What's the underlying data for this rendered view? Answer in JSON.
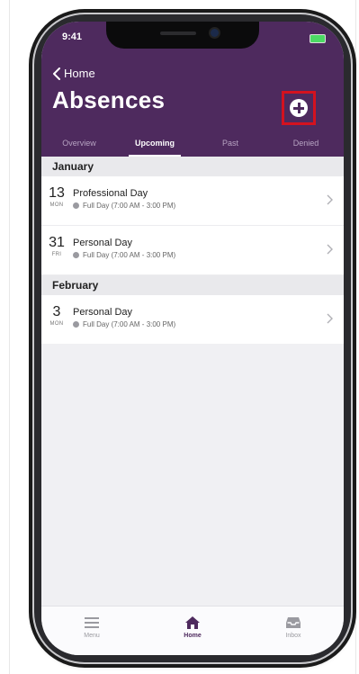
{
  "status_bar": {
    "time": "9:41"
  },
  "nav": {
    "back_label": "Home",
    "title": "Absences"
  },
  "tabs": [
    {
      "label": "Overview",
      "active": false
    },
    {
      "label": "Upcoming",
      "active": true
    },
    {
      "label": "Past",
      "active": false
    },
    {
      "label": "Denied",
      "active": false
    }
  ],
  "sections": [
    {
      "month": "January",
      "items": [
        {
          "day": "13",
          "dow": "MON",
          "name": "Professional Day",
          "detail": "Full Day (7:00 AM - 3:00 PM)"
        },
        {
          "day": "31",
          "dow": "FRI",
          "name": "Personal Day",
          "detail": "Full Day (7:00 AM - 3:00 PM)"
        }
      ]
    },
    {
      "month": "February",
      "items": [
        {
          "day": "3",
          "dow": "MON",
          "name": "Personal Day",
          "detail": "Full Day (7:00 AM - 3:00 PM)"
        }
      ]
    }
  ],
  "tabbar": [
    {
      "label": "Menu",
      "icon": "menu-icon",
      "active": false
    },
    {
      "label": "Home",
      "icon": "home-icon",
      "active": true
    },
    {
      "label": "Inbox",
      "icon": "inbox-icon",
      "active": false
    }
  ],
  "colors": {
    "header": "#4e2a5e",
    "highlight": "#d4121f"
  }
}
